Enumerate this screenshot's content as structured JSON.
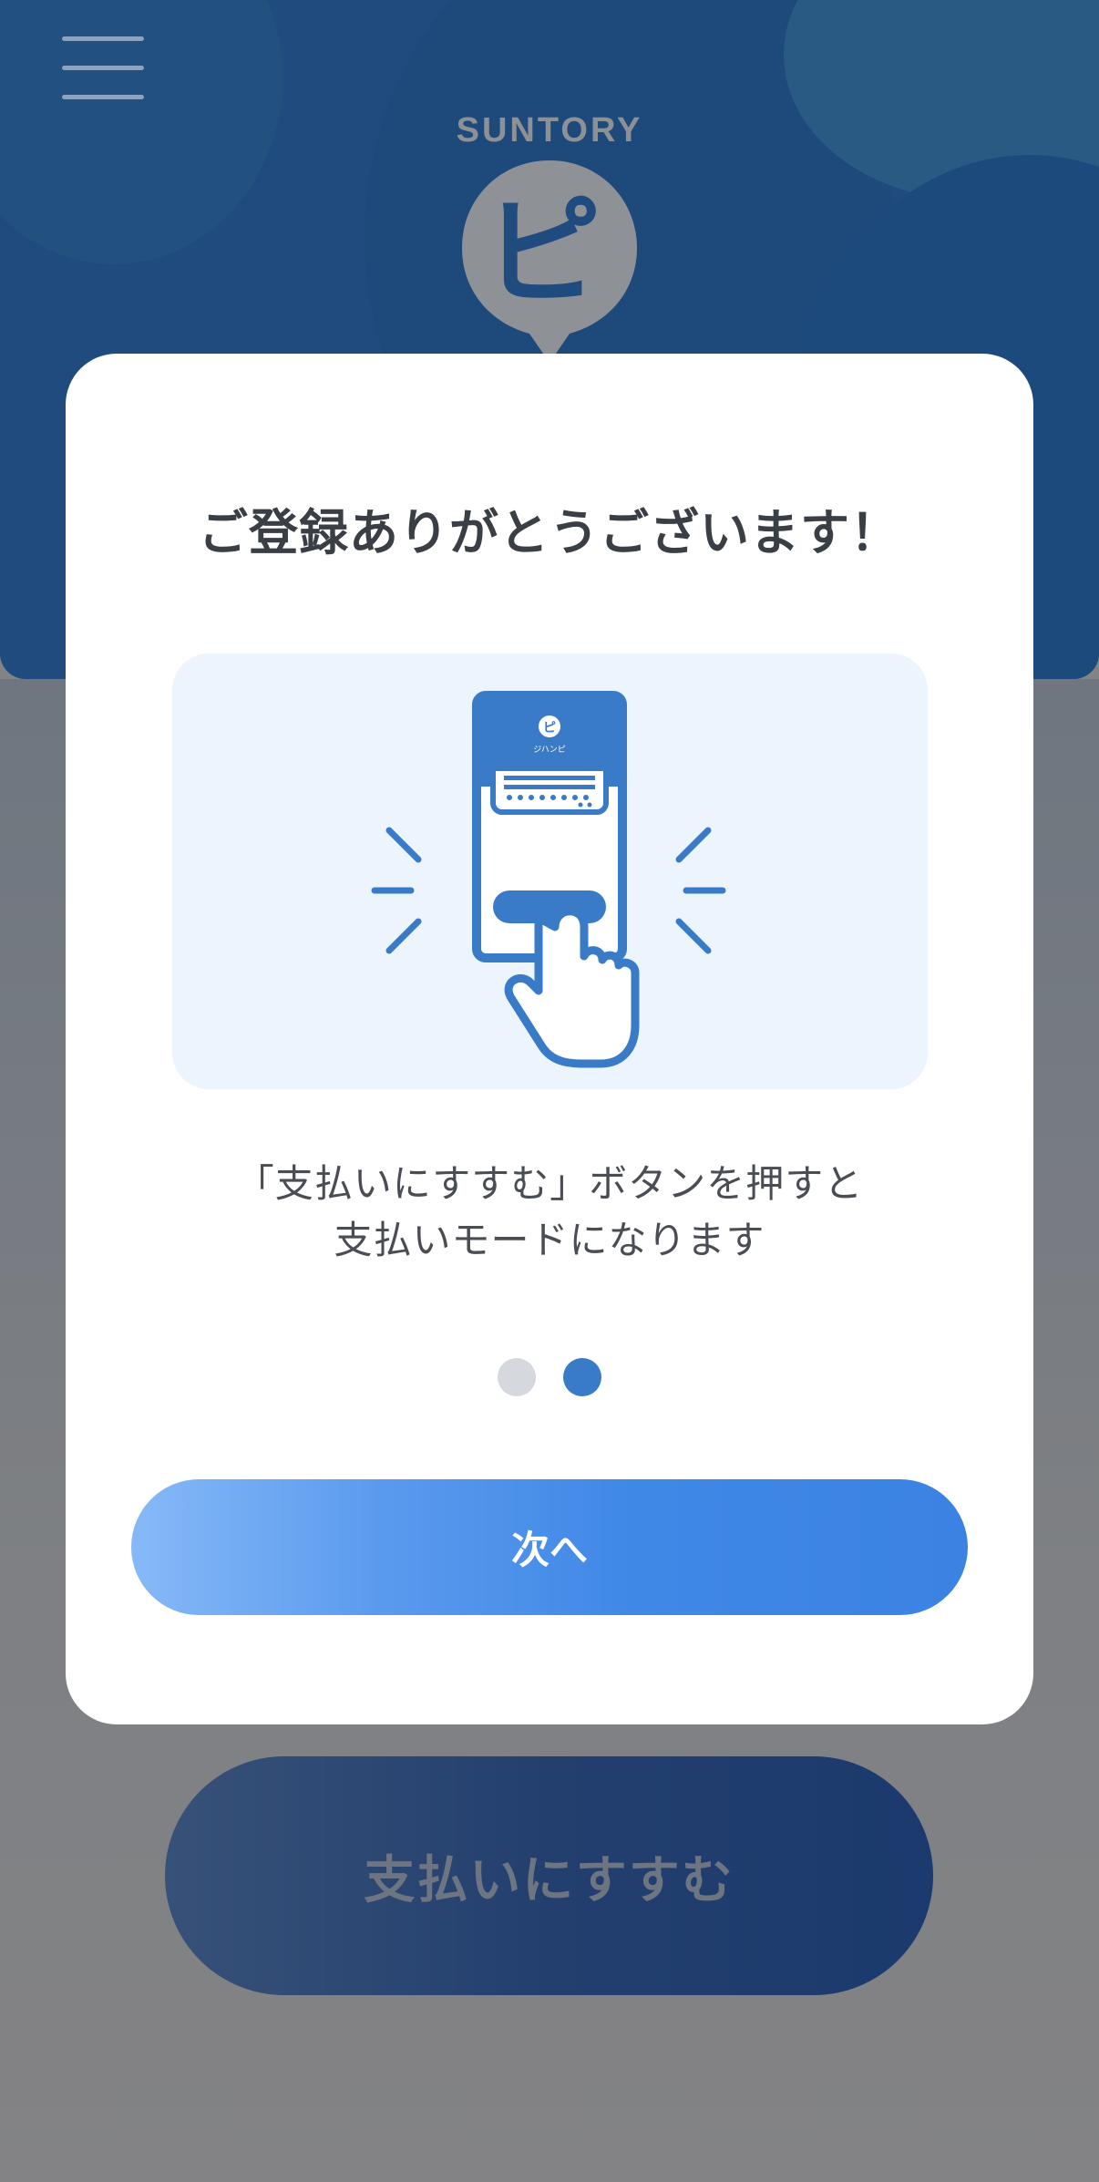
{
  "background": {
    "brand": "SUNTORY",
    "logo_glyph": "ピ",
    "pay_button_label": "支払いにすすむ"
  },
  "menu": {
    "icon": "hamburger-icon"
  },
  "modal": {
    "title": "ご登録ありがとうございます！",
    "illustration": {
      "icon": "phone-tap-icon",
      "phone_brand": "ジハンピ"
    },
    "description_line1": "「支払いにすすむ」ボタンを押すと",
    "description_line2": "支払いモードになります",
    "pagination": {
      "total": 2,
      "current": 2
    },
    "next_label": "次へ"
  },
  "colors": {
    "accent": "#3a7bc8",
    "header_bg": "#1f4b7e",
    "overlay": "#828385"
  }
}
